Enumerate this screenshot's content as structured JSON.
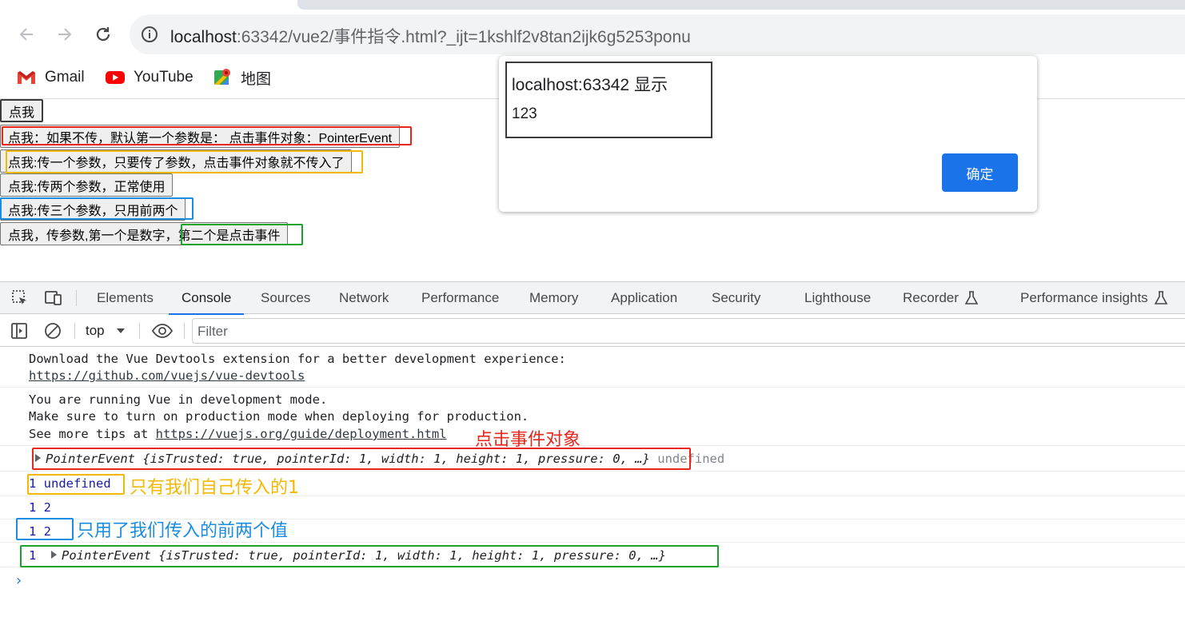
{
  "browser": {
    "url_host": "localhost",
    "url_rest": ":63342/vue2/事件指令.html?_ijt=1kshlf2v8tan2ijk6g5253ponu",
    "bookmarks": [
      {
        "label": "Gmail",
        "icon": "gmail-icon"
      },
      {
        "label": "YouTube",
        "icon": "youtube-icon"
      },
      {
        "label": "地图",
        "icon": "maps-icon"
      }
    ]
  },
  "page": {
    "buttons": [
      "点我",
      "点我：如果不传，默认第一个参数是： 点击事件对象：PointerEvent",
      "点我:传一个参数，只要传了参数，点击事件对象就不传入了",
      "点我:传两个参数，正常使用",
      "点我:传三个参数，只用前两个",
      "点我，传参数,第一个是数字，第二个是点击事件"
    ]
  },
  "dialog": {
    "title": "localhost:63342 显示",
    "message": "123",
    "ok_label": "确定"
  },
  "devtools": {
    "tabs": [
      "Elements",
      "Console",
      "Sources",
      "Network",
      "Performance",
      "Memory",
      "Application",
      "Security",
      "Lighthouse",
      "Recorder",
      "Performance insights"
    ],
    "active_tab": "Console",
    "context": "top",
    "filter_placeholder": "Filter",
    "logs": {
      "l1_text": "Download the Vue Devtools extension for a better development experience:",
      "l1_link": "https://github.com/vuejs/vue-devtools",
      "l2_a": "You are running Vue in development mode.",
      "l2_b": "Make sure to turn on production mode when deploying for production.",
      "l2_c_prefix": "See more tips at ",
      "l2_c_link": "https://vuejs.org/guide/deployment.html",
      "l3_obj": "PointerEvent",
      "l3_props": "{isTrusted: true, pointerId: 1, width: 1, height: 1, pressure: 0, …}",
      "l3_tail": "undefined",
      "l4": "1 undefined",
      "l5": "1 2",
      "l6": "1 2",
      "l7_num": "1",
      "l7_obj": "PointerEvent",
      "l7_props": "{isTrusted: true, pointerId: 1, width: 1, height: 1, pressure: 0, …}"
    }
  },
  "annotations": {
    "a1": "点击事件对象",
    "a2": "只有我们自己传入的1",
    "a3": "只用了我们传入的前两个值"
  },
  "colors": {
    "red": "#e8261a",
    "orange": "#f5b800",
    "blue": "#1b8de0",
    "green": "#1aa32a",
    "accent": "#1a73e8"
  }
}
